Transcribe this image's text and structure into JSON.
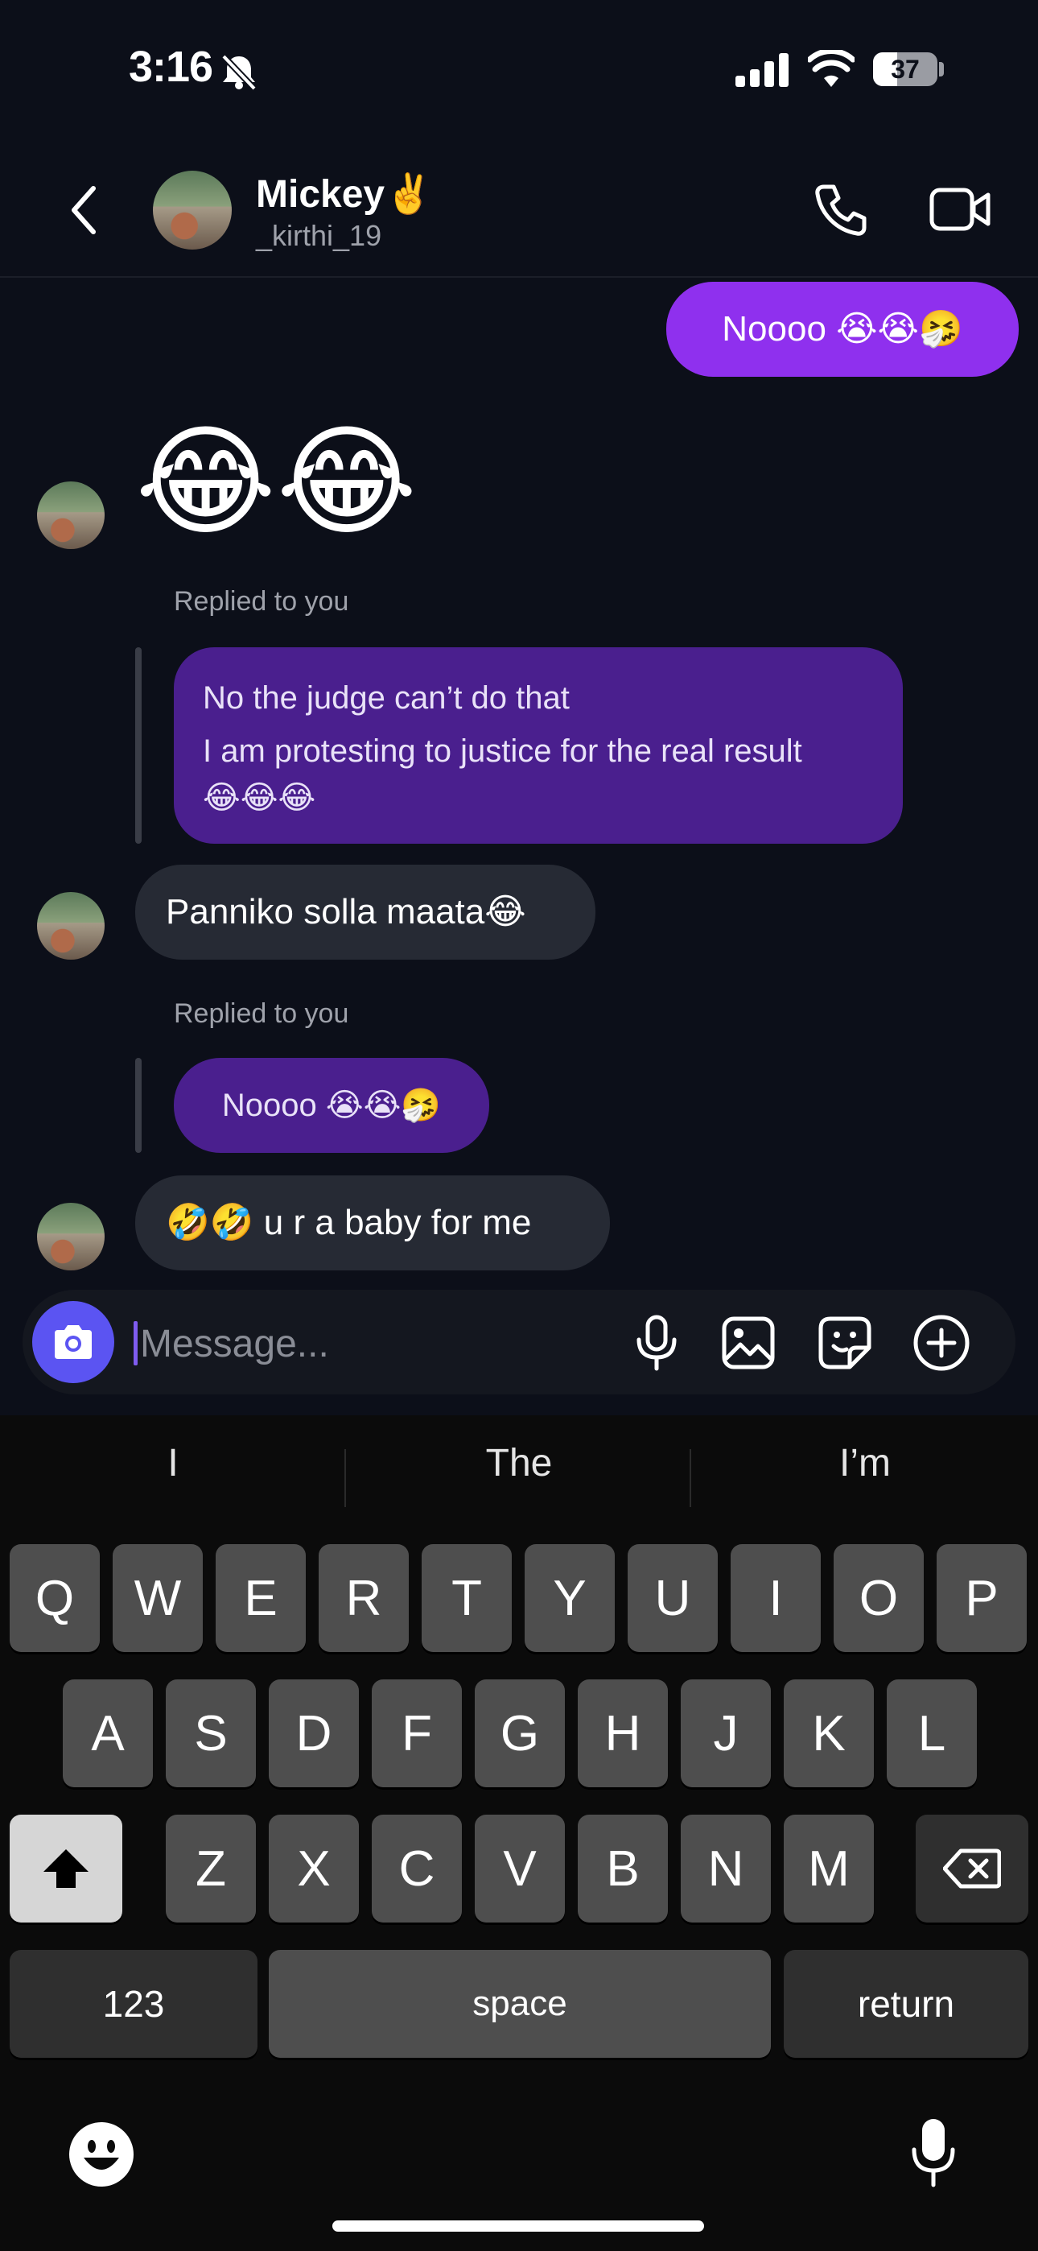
{
  "status": {
    "time": "3:16",
    "battery": "37",
    "battery_level": 0.37
  },
  "header": {
    "name": "Mickey",
    "name_emoji": "✌️",
    "handle": "_kirthi_19"
  },
  "messages": {
    "out1": "Noooo 😭😭🤧",
    "in_emoji": "😂😂",
    "reply1_label": "Replied to you",
    "reply1_line1": "No the judge can’t do that",
    "reply1_line2": "I am protesting to justice for the real result",
    "reply1_line3": "😂😂😂",
    "in2": "Panniko solla maata😂",
    "reply2_label": "Replied to you",
    "reply2_text": "Noooo 😭😭🤧",
    "in3": "🤣🤣 u r a baby for me"
  },
  "composer": {
    "placeholder": "Message..."
  },
  "keyboard": {
    "suggestions": [
      "I",
      "The",
      "I’m"
    ],
    "row1": [
      "Q",
      "W",
      "E",
      "R",
      "T",
      "Y",
      "U",
      "I",
      "O",
      "P"
    ],
    "row2": [
      "A",
      "S",
      "D",
      "F",
      "G",
      "H",
      "J",
      "K",
      "L"
    ],
    "row3": [
      "Z",
      "X",
      "C",
      "V",
      "B",
      "N",
      "M"
    ],
    "numbers": "123",
    "space": "space",
    "return": "return"
  },
  "colors": {
    "outgoing": "#8f30ee",
    "incoming": "#262a34",
    "reply": "#4a1f8e",
    "camera": "#5b54f2"
  },
  "icons": [
    "back-icon",
    "phone-icon",
    "video-icon",
    "camera-icon",
    "mic-icon",
    "image-icon",
    "sticker-icon",
    "plus-icon",
    "shift-icon",
    "delete-icon",
    "emoji-icon",
    "dictation-icon",
    "bell-slash-icon",
    "signal-icon",
    "wifi-icon"
  ]
}
